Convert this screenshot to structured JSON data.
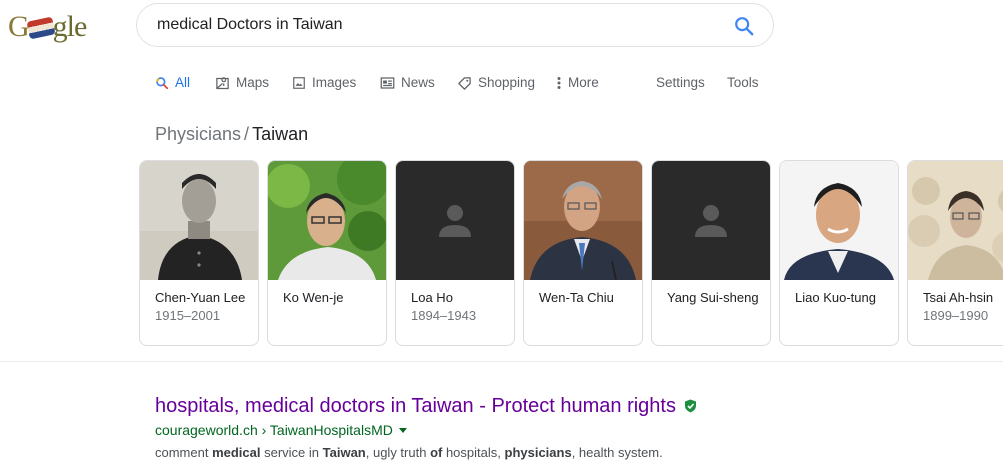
{
  "logo": {
    "text_a": "G",
    "text_b": "gle"
  },
  "search": {
    "query": "medical Doctors in Taiwan"
  },
  "tabs": [
    {
      "label": "All",
      "icon": "search-icon",
      "active": true
    },
    {
      "label": "Maps",
      "icon": "map-icon"
    },
    {
      "label": "Images",
      "icon": "image-icon"
    },
    {
      "label": "News",
      "icon": "news-icon"
    },
    {
      "label": "Shopping",
      "icon": "tag-icon"
    },
    {
      "label": "More",
      "icon": "more-vert-icon"
    },
    {
      "label": "Settings"
    },
    {
      "label": "Tools"
    }
  ],
  "breadcrumb": {
    "parent": "Physicians",
    "separator": "/",
    "current": "Taiwan"
  },
  "carousel": [
    {
      "name": "Chen-Yuan Lee",
      "years": "1915–2001"
    },
    {
      "name": "Ko Wen-je",
      "years": ""
    },
    {
      "name": "Loa Ho",
      "years": "1894–1943"
    },
    {
      "name": "Wen-Ta Chiu",
      "years": ""
    },
    {
      "name": "Yang Sui-sheng",
      "years": ""
    },
    {
      "name": "Liao Kuo-tung",
      "years": ""
    },
    {
      "name": "Tsai Ah-hsin",
      "years": "1899–1990"
    }
  ],
  "result": {
    "title": "hospitals, medical doctors in Taiwan - Protect human rights",
    "url": "courageworld.ch › TaiwanHospitalsMD",
    "snippet": {
      "p1": "comment ",
      "b1": "medical",
      "p2": " service in ",
      "b2": "Taiwan",
      "p3": ", ugly truth ",
      "b3": "of",
      "p4": " hospitals, ",
      "b4": "physicians",
      "p5": ", health system."
    }
  },
  "colors": {
    "link_visited": "#660099",
    "url_green": "#006621",
    "accent_blue": "#1a73e8"
  }
}
